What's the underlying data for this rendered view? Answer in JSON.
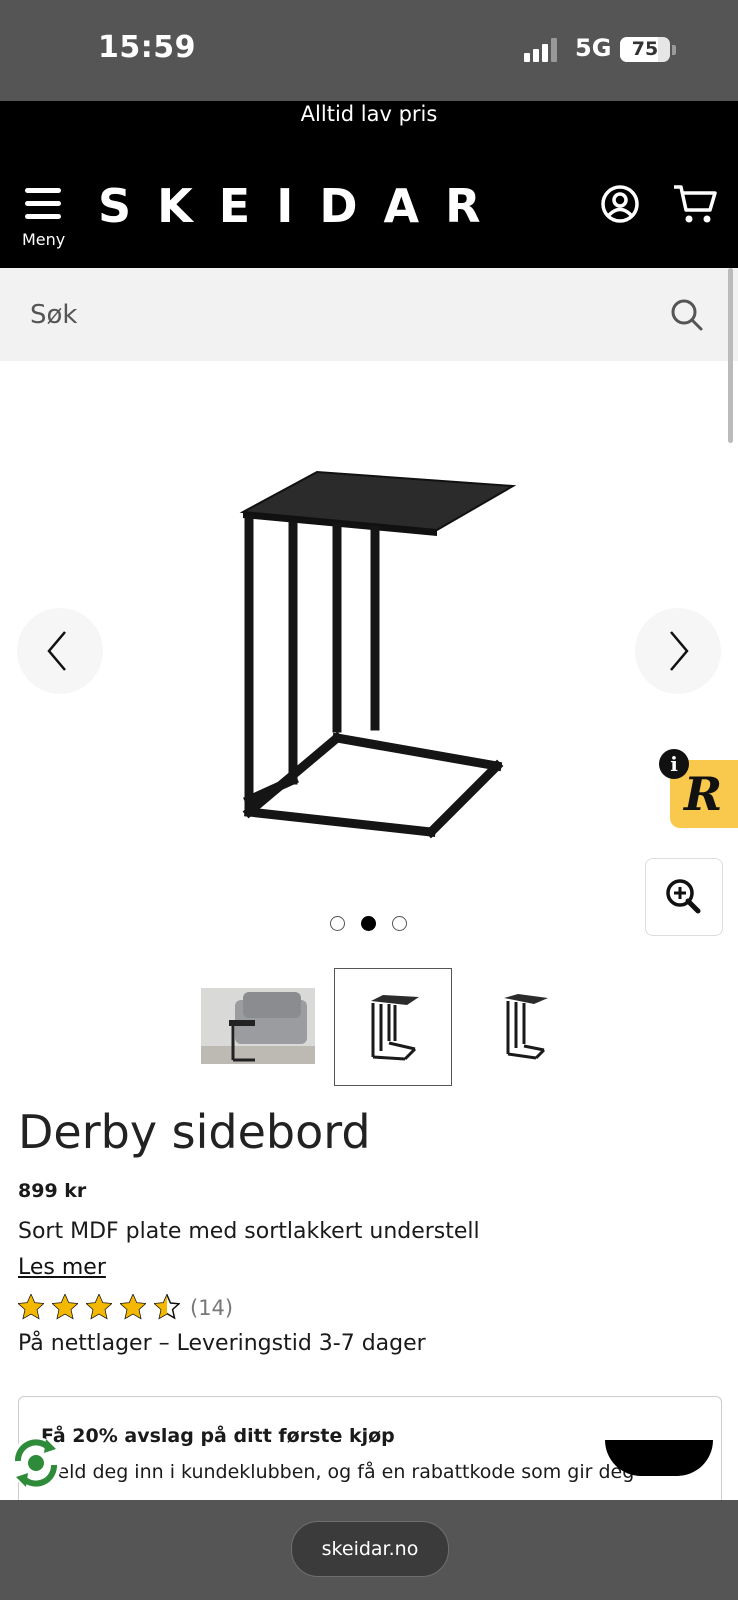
{
  "status_bar": {
    "time": "15:59",
    "network": "5G",
    "battery": "75",
    "battery_level": 0.75
  },
  "promo_banner": {
    "text": "Alltid lav pris"
  },
  "header": {
    "menu_label": "Meny",
    "logo": "SKEIDAR",
    "icons": [
      "account-icon",
      "cart-icon",
      "hamburger-menu-icon"
    ]
  },
  "search": {
    "placeholder": "Søk",
    "icon": "search-icon"
  },
  "gallery": {
    "image_count": 3,
    "active_index": 1,
    "prev_icon": "chevron-left-icon",
    "next_icon": "chevron-right-icon",
    "zoom_icon": "zoom-in-icon",
    "selected_thumbnail": 1
  },
  "widget": {
    "badge_letter": "R",
    "info_symbol": "i",
    "color": "#f8c94d"
  },
  "product": {
    "title": "Derby sidebord",
    "price": "899 kr",
    "description": "Sort MDF plate med sortlakkert understell",
    "read_more": "Les mer",
    "rating": 4.5,
    "rating_max": 5,
    "review_count": "(14)",
    "stock_status": "På nettlager – Leveringstid 3-7 dager",
    "star_color": "#f5b800"
  },
  "club_offer": {
    "title": "Få 20% avslag på ditt første kjøp",
    "text": "Meld deg inn i kundeklubben, og få en rabattkode som gir deg"
  },
  "browser": {
    "url": "skeidar.no"
  }
}
